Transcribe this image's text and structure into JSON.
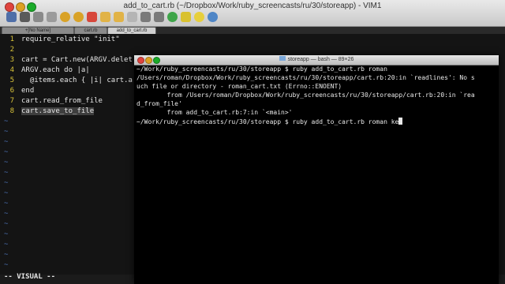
{
  "vim": {
    "title": "add_to_cart.rb (~/Dropbox/Work/ruby_screencasts/ru/30/storeapp) - VIM1",
    "tabs": [
      "+[No Name]",
      "cart.rb",
      "add_to_cart.rb"
    ],
    "lines": [
      {
        "num": "1",
        "text": "require_relative \"init\""
      },
      {
        "num": "2",
        "text": ""
      },
      {
        "num": "3",
        "text": "cart = Cart.new(ARGV.delet"
      },
      {
        "num": "4",
        "text": "ARGV.each do |a|"
      },
      {
        "num": "5",
        "text": "  @items.each { |i| cart.a"
      },
      {
        "num": "6",
        "text": "end"
      },
      {
        "num": "7",
        "text": "cart.read_from_file"
      },
      {
        "num": "8",
        "text": "cart.save_to_file"
      }
    ],
    "tilde": "~",
    "status": "-- VISUAL --",
    "colors": {
      "line_numbers": "#d7c23a",
      "tilde": "#4a6fb0",
      "background": "#141414"
    }
  },
  "terminal": {
    "title": "storeapp — bash — 89×26",
    "lines": [
      "~/Work/ruby_screencasts/ru/30/storeapp $ ruby add_to_cart.rb roman",
      "/Users/roman/Dropbox/Work/ruby_screencasts/ru/30/storeapp/cart.rb:20:in `readlines': No s",
      "uch file or directory - roman_cart.txt (Errno::ENOENT)",
      "        from /Users/roman/Dropbox/Work/ruby_screencasts/ru/30/storeapp/cart.rb:20:in `rea",
      "d_from_file'",
      "        from add_to_cart.rb:7:in `<main>'",
      "~/Work/ruby_screencasts/ru/30/storeapp $ ruby add_to_cart.rb roman ke"
    ]
  }
}
